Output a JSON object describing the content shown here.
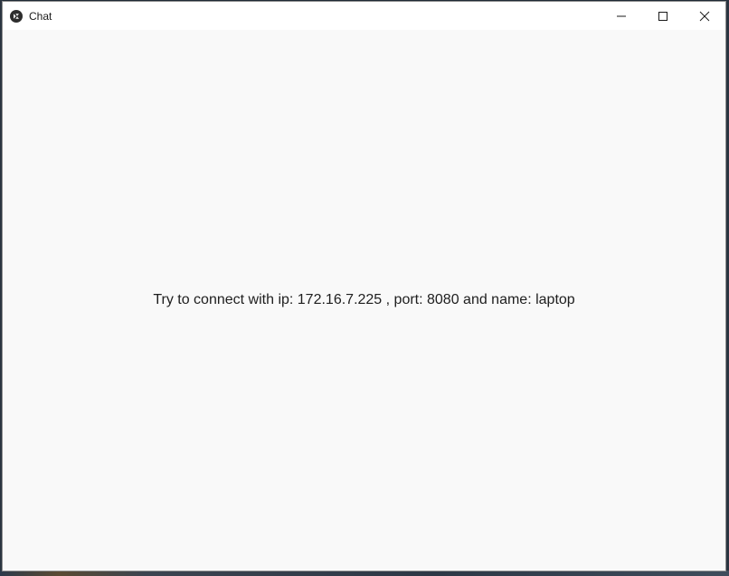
{
  "window": {
    "title": "Chat",
    "icons": {
      "app": "kivy-app-icon",
      "minimize": "minimize-icon",
      "maximize": "maximize-icon",
      "close": "close-icon"
    }
  },
  "main": {
    "status_message": "Try to connect with ip: 172.16.7.225 , port: 8080 and name: laptop"
  },
  "colors": {
    "window_background": "#f9f9f9",
    "titlebar_background": "#ffffff",
    "text": "#1e1e1e"
  }
}
